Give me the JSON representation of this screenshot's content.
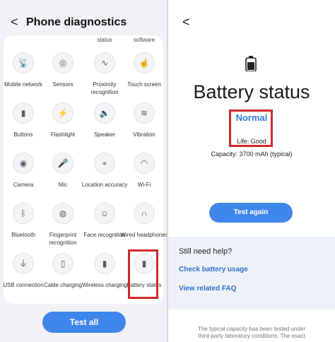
{
  "left": {
    "back_glyph": "<",
    "title": "Phone diagnostics",
    "top_captions": [
      "status",
      "software"
    ],
    "tiles": [
      {
        "label": "Mobile network",
        "glyph": "📡",
        "icon": "antenna-icon"
      },
      {
        "label": "Sensors",
        "glyph": "◎",
        "icon": "sensor-icon"
      },
      {
        "label": "Proximity recognition",
        "glyph": "∿",
        "icon": "proximity-icon"
      },
      {
        "label": "Touch screen",
        "glyph": "☝",
        "icon": "touch-icon"
      },
      {
        "label": "Buttons",
        "glyph": "▮",
        "icon": "buttons-icon"
      },
      {
        "label": "Flashlight",
        "glyph": "⚡",
        "icon": "flashlight-icon"
      },
      {
        "label": "Speaker",
        "glyph": "🔈",
        "icon": "speaker-icon"
      },
      {
        "label": "Vibration",
        "glyph": "≋",
        "icon": "vibration-icon"
      },
      {
        "label": "Camera",
        "glyph": "◉",
        "icon": "camera-icon"
      },
      {
        "label": "Mic",
        "glyph": "🎤",
        "icon": "mic-icon"
      },
      {
        "label": "Location accuracy",
        "glyph": "⌖",
        "icon": "location-icon"
      },
      {
        "label": "Wi-Fi",
        "glyph": "◠",
        "icon": "wifi-icon"
      },
      {
        "label": "Bluetooth",
        "glyph": "ᛒ",
        "icon": "bluetooth-icon"
      },
      {
        "label": "Fingerprint recognition",
        "glyph": "◍",
        "icon": "fingerprint-icon"
      },
      {
        "label": "Face recognition",
        "glyph": "☺",
        "icon": "face-icon"
      },
      {
        "label": "Wired headphones",
        "glyph": "∩",
        "icon": "headphones-icon"
      },
      {
        "label": "USB connection",
        "glyph": "⏚",
        "icon": "usb-icon"
      },
      {
        "label": "Cable charging",
        "glyph": "▯",
        "icon": "cable-charging-icon"
      },
      {
        "label": "Wireless charging",
        "glyph": "▮",
        "icon": "wireless-charging-icon"
      },
      {
        "label": "Battery status",
        "glyph": "▮",
        "icon": "battery-icon"
      }
    ],
    "test_all": "Test all"
  },
  "right": {
    "back_glyph": "<",
    "title": "Battery status",
    "status": "Normal",
    "life": "Life: Good",
    "capacity": "Capacity: 3700 mAh (typical)",
    "test_again": "Test again",
    "help_title": "Still need help?",
    "link_usage": "Check battery usage",
    "link_faq": "View related FAQ",
    "footer_1": "The typical capacity has been tested under",
    "footer_2": "third-party laboratory conditions. The exact"
  },
  "colors": {
    "accent": "#3f86ea",
    "highlight": "#d0282a",
    "link": "#2f6fc9",
    "status": "#2f7fda"
  }
}
